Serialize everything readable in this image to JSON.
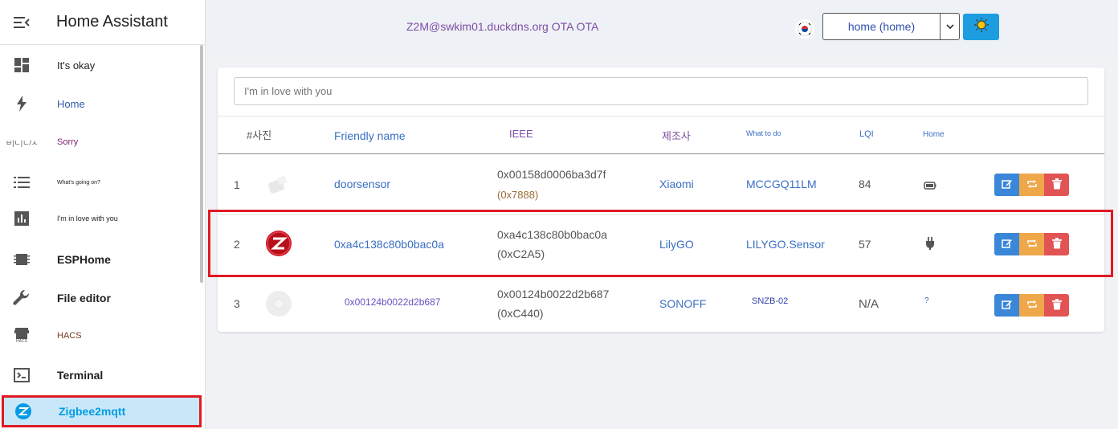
{
  "sidebar": {
    "title": "Home Assistant",
    "items": [
      {
        "label": "It's okay",
        "icon": "dashboard-icon"
      },
      {
        "label": "Home",
        "icon": "lightning-icon"
      },
      {
        "label": "Sorry",
        "icon": "text-logo-icon",
        "icon_text": "ㅂ|ㄴ|ㄴ/ㅅ"
      },
      {
        "label": "What's going on?",
        "icon": "list-icon"
      },
      {
        "label": "I'm in love with you",
        "icon": "chart-icon"
      },
      {
        "label": "ESPHome",
        "icon": "chip-icon"
      },
      {
        "label": "File editor",
        "icon": "wrench-icon"
      },
      {
        "label": "HACS",
        "icon": "store-icon",
        "icon_text": "HACS"
      },
      {
        "label": "Terminal",
        "icon": "terminal-icon"
      },
      {
        "label": "Zigbee2mqtt",
        "icon": "zigbee-icon"
      }
    ]
  },
  "topbar": {
    "title": "Z2M@swkim01.duckdns.org OTA OTA",
    "flag": "kr-flag-icon",
    "select_value": "home (home)",
    "theme_button": "sun-icon"
  },
  "search": {
    "placeholder": "I'm in love with you"
  },
  "table": {
    "headers": {
      "pic": "#사진",
      "friendly": "Friendly name",
      "ieee": "IEEE",
      "manufacturer": "제조사",
      "model": "What to do",
      "lqi": "LQI",
      "power": "Home"
    },
    "rows": [
      {
        "num": "1",
        "friendly": "doorsensor",
        "ieee": "0x00158d0006ba3d7f",
        "nwk": "(0x7888)",
        "manufacturer": "Xiaomi",
        "model": "MCCGQ11LM",
        "lqi": "84",
        "power": "battery-icon"
      },
      {
        "num": "2",
        "friendly": "0xa4c138c80b0bac0a",
        "ieee": "0xa4c138c80b0bac0a",
        "nwk": "(0xC2A5)",
        "manufacturer": "LilyGO",
        "model": "LILYGO.Sensor",
        "lqi": "57",
        "power": "plug-icon"
      },
      {
        "num": "3",
        "friendly": "0x00124b0022d2b687",
        "ieee": "0x00124b0022d2b687",
        "nwk": "(0xC440)",
        "manufacturer": "SONOFF",
        "model": "SNZB-02",
        "lqi": "N/A",
        "power_text": "?"
      }
    ]
  },
  "colors": {
    "accent": "#039be5",
    "highlight": "#e01a22",
    "edit": "#3a86d8",
    "swap": "#eea84a",
    "delete": "#e25353"
  }
}
